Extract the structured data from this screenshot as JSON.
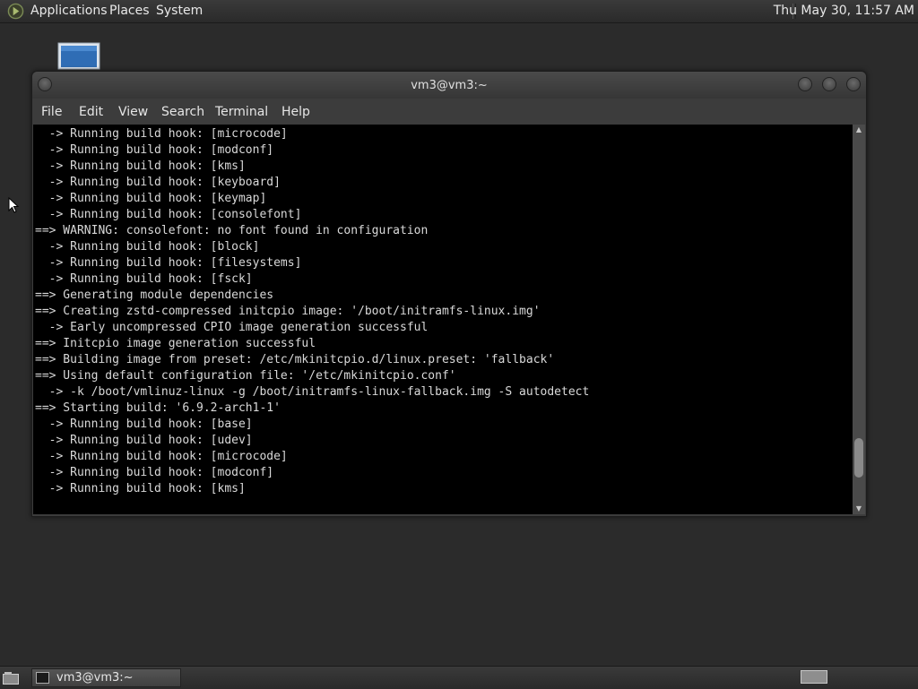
{
  "top_panel": {
    "menus": [
      "Applications",
      "Places",
      "System"
    ],
    "clock": "Thu May 30, 11:57 AM"
  },
  "desktop": {
    "icon": "computer-icon"
  },
  "window": {
    "title": "vm3@vm3:~",
    "menu": [
      "File",
      "Edit",
      "View",
      "Search",
      "Terminal",
      "Help"
    ],
    "controls": [
      "minimize-icon",
      "maximize-icon",
      "close-icon"
    ]
  },
  "terminal": {
    "lines": [
      "  -> Running build hook: [microcode]",
      "  -> Running build hook: [modconf]",
      "  -> Running build hook: [kms]",
      "  -> Running build hook: [keyboard]",
      "  -> Running build hook: [keymap]",
      "  -> Running build hook: [consolefont]",
      "==> WARNING: consolefont: no font found in configuration",
      "  -> Running build hook: [block]",
      "  -> Running build hook: [filesystems]",
      "  -> Running build hook: [fsck]",
      "==> Generating module dependencies",
      "==> Creating zstd-compressed initcpio image: '/boot/initramfs-linux.img'",
      "  -> Early uncompressed CPIO image generation successful",
      "==> Initcpio image generation successful",
      "==> Building image from preset: /etc/mkinitcpio.d/linux.preset: 'fallback'",
      "==> Using default configuration file: '/etc/mkinitcpio.conf'",
      "  -> -k /boot/vmlinuz-linux -g /boot/initramfs-linux-fallback.img -S autodetect",
      "==> Starting build: '6.9.2-arch1-1'",
      "  -> Running build hook: [base]",
      "  -> Running build hook: [udev]",
      "  -> Running build hook: [microcode]",
      "  -> Running build hook: [modconf]",
      "  -> Running build hook: [kms]"
    ],
    "scroll_position": 0.92
  },
  "bottom_panel": {
    "task_label": "vm3@vm3:~",
    "task_icon": "terminal-icon",
    "show_desktop_icon": "show-desktop-icon",
    "workspace": "workspace-switcher"
  },
  "colors": {
    "terminal_bg": "#000000",
    "terminal_fg": "#d9d9d9",
    "desktop_bg": "#2b2b2b"
  }
}
